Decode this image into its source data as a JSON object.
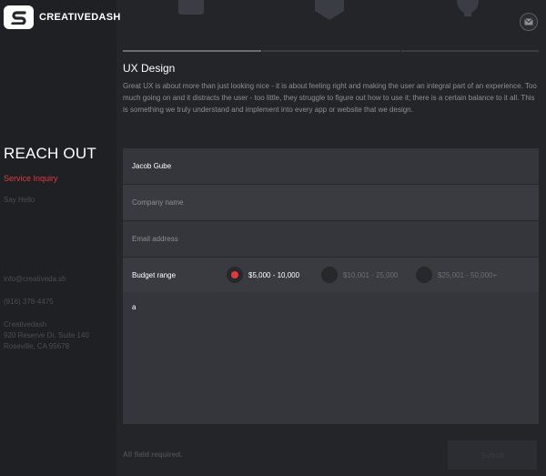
{
  "brand": {
    "name": "CREATIVEDASH"
  },
  "sidebar": {
    "heading": "REACH OUT",
    "nav": [
      {
        "label": "Service Inquiry",
        "active": true
      },
      {
        "label": "Say Hello",
        "active": false
      }
    ],
    "contact": {
      "email": "info@creativeda.sh",
      "phone": "(916) 378-4475",
      "company": "Creativedash",
      "address_line1": "920 Reserve Dr. Suite 140",
      "address_line2": "Roseville, CA 95678"
    }
  },
  "service": {
    "title": "UX Design",
    "description": "Great UX is about more than just looking nice - it is about feeling right and making the user an integral part of an experience. Too much going on and it distracts the user - too little, they struggle to figure out how to use it; there is a certain balance to it all. This is something we truly understand and implement into every app or website that we design."
  },
  "form": {
    "name_value": "Jacob Gube",
    "company_placeholder": "Company name",
    "email_placeholder": "Email address",
    "budget_label": "Budget range",
    "budget_options": [
      {
        "label": "$5,000 - 10,000",
        "selected": true
      },
      {
        "label": "$10,001 - 25,000",
        "selected": false
      },
      {
        "label": "$25,001 - 50,000+",
        "selected": false
      }
    ],
    "message_value": "a",
    "required_note": "All field required.",
    "submit_label": "Submit"
  },
  "colors": {
    "accent": "#e0393e",
    "background": "#232529",
    "sidebar": "#1e2024",
    "field": "#34363b"
  },
  "icons": [
    "logo-mark-icon",
    "pencil-icon",
    "shield-icon",
    "bulb-icon",
    "mail-icon"
  ]
}
